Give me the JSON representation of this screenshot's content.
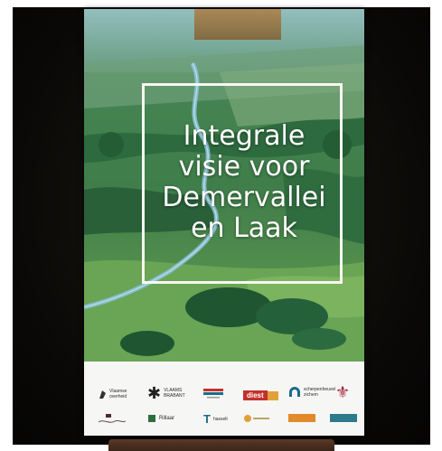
{
  "poster": {
    "title_lines": [
      "Integrale",
      "visie voor",
      "Demervallei",
      "en Laak"
    ]
  },
  "logos": {
    "vlaamse_overheid": [
      "Vlaamse",
      "overheid"
    ],
    "vlaams_brabant": [
      "VLAAMS",
      "BRABANT"
    ],
    "diest": "diest",
    "bekkensecretariaat": [
      "scherpenheuvel",
      "zichem"
    ],
    "rillaar": "Rillaar",
    "tienen": "hasselt",
    "scherpenheuvel": "scherpenheuvel"
  },
  "colors": {
    "background_dark": "#0a0907",
    "poster_white": "#f4f4f1",
    "meadow_green": "#5f9a57",
    "forest_green": "#2f6a3f",
    "river_blue": "#7fb9d3",
    "logo_red": "#c4302b",
    "logo_teal": "#1c6b8a"
  }
}
